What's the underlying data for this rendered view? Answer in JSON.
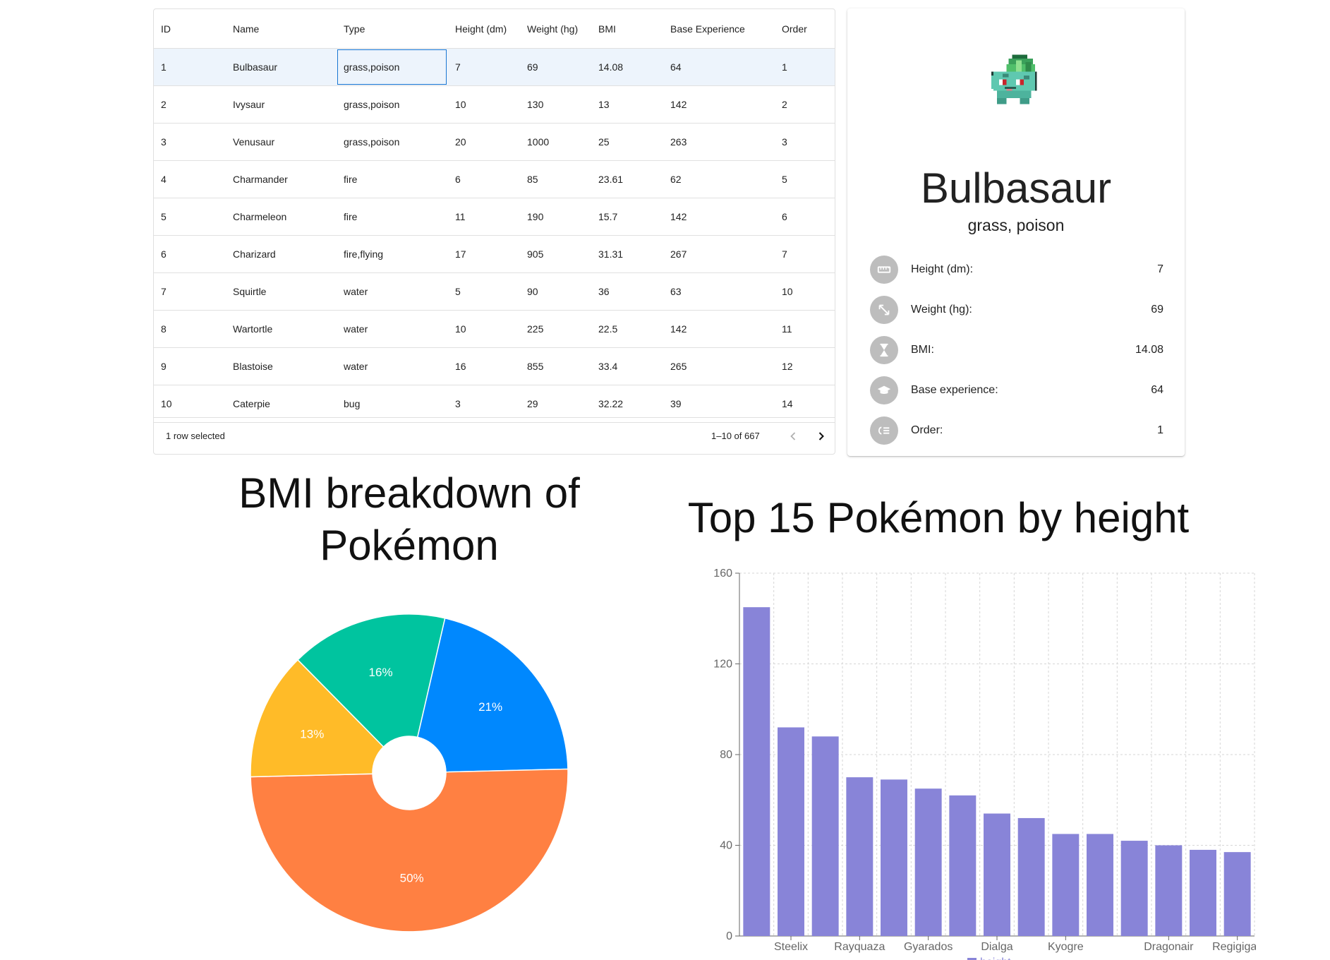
{
  "grid": {
    "columns": [
      "ID",
      "Name",
      "Type",
      "Height (dm)",
      "Weight (hg)",
      "BMI",
      "Base Experience",
      "Order"
    ],
    "rows": [
      [
        "1",
        "Bulbasaur",
        "grass,poison",
        "7",
        "69",
        "14.08",
        "64",
        "1"
      ],
      [
        "2",
        "Ivysaur",
        "grass,poison",
        "10",
        "130",
        "13",
        "142",
        "2"
      ],
      [
        "3",
        "Venusaur",
        "grass,poison",
        "20",
        "1000",
        "25",
        "263",
        "3"
      ],
      [
        "4",
        "Charmander",
        "fire",
        "6",
        "85",
        "23.61",
        "62",
        "5"
      ],
      [
        "5",
        "Charmeleon",
        "fire",
        "11",
        "190",
        "15.7",
        "142",
        "6"
      ],
      [
        "6",
        "Charizard",
        "fire,flying",
        "17",
        "905",
        "31.31",
        "267",
        "7"
      ],
      [
        "7",
        "Squirtle",
        "water",
        "5",
        "90",
        "36",
        "63",
        "10"
      ],
      [
        "8",
        "Wartortle",
        "water",
        "10",
        "225",
        "22.5",
        "142",
        "11"
      ],
      [
        "9",
        "Blastoise",
        "water",
        "16",
        "855",
        "33.4",
        "265",
        "12"
      ],
      [
        "10",
        "Caterpie",
        "bug",
        "3",
        "29",
        "32.22",
        "39",
        "14"
      ]
    ],
    "selected_row": 0,
    "focused_col": 2,
    "footer": {
      "selected_text": "1 row selected",
      "page_range": "1–10 of 667"
    }
  },
  "card": {
    "name": "Bulbasaur",
    "types": "grass, poison",
    "stats": [
      {
        "icon": "ruler-icon",
        "label": "Height (dm):",
        "value": "7"
      },
      {
        "icon": "arrows-expand-icon",
        "label": "Weight (hg):",
        "value": "69"
      },
      {
        "icon": "hourglass-icon",
        "label": "BMI:",
        "value": "14.08"
      },
      {
        "icon": "graduation-cap-icon",
        "label": "Base experience:",
        "value": "64"
      },
      {
        "icon": "list-order-icon",
        "label": "Order:",
        "value": "1"
      }
    ]
  },
  "chart_data": [
    {
      "type": "pie",
      "title": "BMI breakdown of Pokémon",
      "slices": [
        {
          "value": 21,
          "label": "21%",
          "color": "#0088fe"
        },
        {
          "value": 50,
          "label": "50%",
          "color": "#ff8042"
        },
        {
          "value": 13,
          "label": "13%",
          "color": "#ffbb28"
        },
        {
          "value": 16,
          "label": "16%",
          "color": "#00c49f"
        }
      ]
    },
    {
      "type": "bar",
      "title": "Top 15 Pokémon by height",
      "categories": [
        "",
        "Steelix",
        "",
        "Rayquaza",
        "",
        "Gyarados",
        "",
        "Dialga",
        "",
        "Kyogre",
        "",
        "",
        "Dragonair",
        "",
        "Regigigas"
      ],
      "series": [
        {
          "name": "height",
          "color": "#8884d8",
          "values": [
            145,
            92,
            88,
            70,
            69,
            65,
            62,
            54,
            52,
            45,
            45,
            42,
            40,
            38,
            37
          ]
        }
      ],
      "yticks": [
        0,
        40,
        80,
        120,
        160
      ],
      "ylim": [
        0,
        160
      ],
      "grid": true,
      "legend": "bottom"
    }
  ]
}
